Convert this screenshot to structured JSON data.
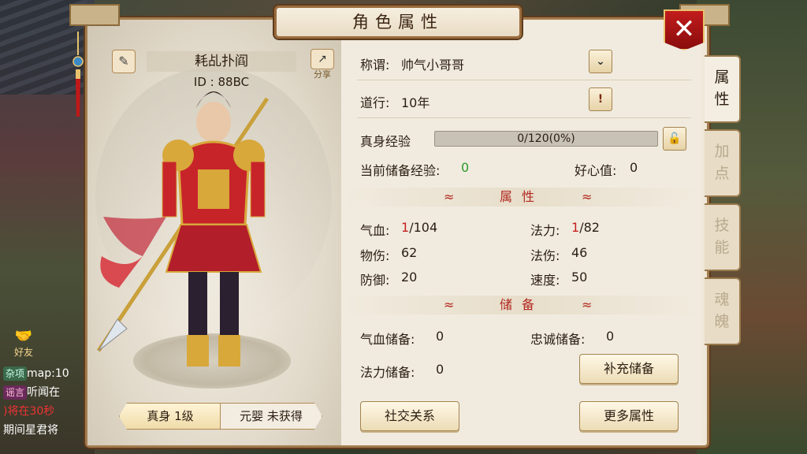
{
  "window": {
    "title": "角色属性",
    "close_label": "✕"
  },
  "character": {
    "name": "耗乩扑阎",
    "id": "ID : 88BC",
    "share_label": "分享",
    "bottom_tabs": [
      "真身 1级",
      "元婴 未获得"
    ]
  },
  "info": {
    "title_label": "称谓:",
    "title_value": "帅气小哥哥",
    "daoxing_label": "道行:",
    "daoxing_value": "10年",
    "exp_label": "真身经验",
    "exp_text": "0/120(0%)",
    "exp_progress": 0,
    "stored_exp_label": "当前储备经验:",
    "stored_exp_value": "0",
    "kindness_label": "好心值:",
    "kindness_value": "0"
  },
  "attributes": {
    "section_label": "属性",
    "hp_label": "气血:",
    "hp_current": "1",
    "hp_max": "/104",
    "mp_label": "法力:",
    "mp_current": "1",
    "mp_max": "/82",
    "phys_label": "物伤:",
    "phys_value": "62",
    "magic_label": "法伤:",
    "magic_value": "46",
    "def_label": "防御:",
    "def_value": "20",
    "speed_label": "速度:",
    "speed_value": "50"
  },
  "reserve": {
    "section_label": "储备",
    "hp_reserve_label": "气血储备:",
    "hp_reserve_value": "0",
    "loyalty_reserve_label": "忠诚储备:",
    "loyalty_reserve_value": "0",
    "mp_reserve_label": "法力储备:",
    "mp_reserve_value": "0",
    "refill_button": "补充储备"
  },
  "buttons": {
    "social": "社交关系",
    "more": "更多属性"
  },
  "side_tabs": [
    {
      "label": "属性",
      "active": true
    },
    {
      "label": "加点",
      "active": false
    },
    {
      "label": "技能",
      "active": false
    },
    {
      "label": "魂魄",
      "active": false
    }
  ],
  "chat": {
    "friend_label": "好友",
    "lines": [
      {
        "tag": "杂项",
        "text": "map:10"
      },
      {
        "tag": "谣言",
        "text": "听闻在"
      },
      {
        "tag": "",
        "text": ")将在30秒"
      },
      {
        "tag": "",
        "text": "期间星君将"
      }
    ]
  },
  "colors": {
    "accent_red": "#b2281f",
    "progress": "#e6a23a",
    "panel_bg": "#efe7d8",
    "frame": "#a37c4e"
  }
}
